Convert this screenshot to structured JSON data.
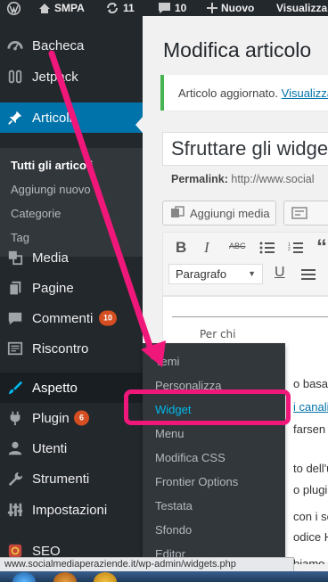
{
  "adminbar": {
    "site_name": "SMPA",
    "updates_count": "11",
    "comments_count": "10",
    "new_label": "Nuovo",
    "visit_label": "Visualizza"
  },
  "sidebar": {
    "items": [
      {
        "label": "Bacheca",
        "icon": "dashboard-icon"
      },
      {
        "label": "Jetpack",
        "icon": "jetpack-icon"
      },
      {
        "label": "Articoli",
        "icon": "pin-icon"
      },
      {
        "label": "Media",
        "icon": "media-icon"
      },
      {
        "label": "Pagine",
        "icon": "page-icon"
      },
      {
        "label": "Commenti",
        "icon": "comment-icon",
        "badge": "10"
      },
      {
        "label": "Riscontro",
        "icon": "feedback-icon"
      },
      {
        "label": "Aspetto",
        "icon": "paintbrush-icon"
      },
      {
        "label": "Plugin",
        "icon": "plugin-icon",
        "badge": "6"
      },
      {
        "label": "Utenti",
        "icon": "users-icon"
      },
      {
        "label": "Strumenti",
        "icon": "wrench-icon"
      },
      {
        "label": "Impostazioni",
        "icon": "settings-icon"
      },
      {
        "label": "SEO",
        "icon": "seo-icon"
      }
    ],
    "articoli_submenu": [
      "Tutti gli articoli",
      "Aggiungi nuovo",
      "Categorie",
      "Tag"
    ]
  },
  "flyout": {
    "items": [
      "Temi",
      "Personalizza",
      "Widget",
      "Menu",
      "Modifica CSS",
      "Frontier Options",
      "Testata",
      "Sfondo",
      "Editor"
    ]
  },
  "main": {
    "page_title": "Modifica articolo",
    "notice_text": "Articolo aggiornato.",
    "notice_link": "Visualizza",
    "post_title": "Sfruttare gli widget",
    "permalink_label": "Permalink:",
    "permalink_url": "http://www.social",
    "add_media_label": "Aggiungi media",
    "format_select": "Paragrafo",
    "editor_heading": "Per chi",
    "editor_lines": [
      "o basato",
      "i canali",
      "farsen",
      "to dell'u",
      "o plugin",
      "con i so",
      "odice H",
      "biamo v"
    ]
  },
  "statusbar": {
    "url": "www.socialmediaperaziende.it/wp-admin/widgets.php"
  },
  "colors": {
    "admin_dark": "#23282d",
    "accent_blue": "#0073aa",
    "highlight_blue": "#00b9eb",
    "badge_orange": "#d54e21",
    "annotation_pink": "#f0177a",
    "notice_green": "#46b450"
  }
}
